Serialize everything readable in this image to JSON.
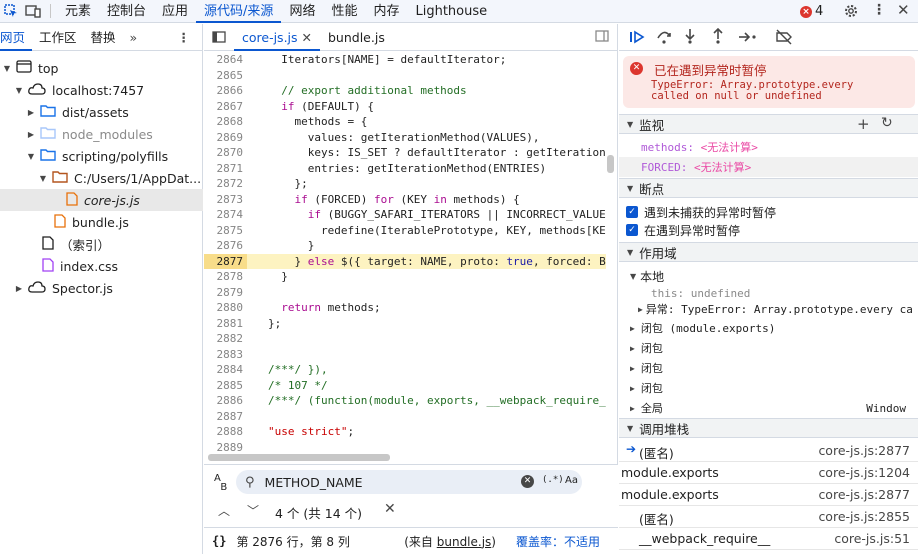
{
  "topbar": {
    "tabs": [
      "元素",
      "控制台",
      "应用",
      "源代码/来源",
      "网络",
      "性能",
      "内存",
      "Lighthouse"
    ],
    "active": "源代码/来源",
    "error_count": "4"
  },
  "navigator": {
    "tabs": [
      "网页",
      "工作区",
      "替换"
    ],
    "tree": [
      "top",
      "localhost:7457",
      "dist/assets",
      "node_modules",
      "scripting/polyfills",
      "C:/Users/1/AppDat...",
      "core-js.js",
      "bundle.js",
      "（索引）",
      "index.css",
      "Spector.js"
    ]
  },
  "editor": {
    "tabs": [
      "core-js.js",
      "bundle.js"
    ],
    "lines": [
      {
        "n": "2864",
        "t": "  Iterators[NAME] = defaultIterator;"
      },
      {
        "n": "2865",
        "t": ""
      },
      {
        "n": "2866",
        "t": "  // export additional methods"
      },
      {
        "n": "2867",
        "t": "  if (DEFAULT) {"
      },
      {
        "n": "2868",
        "t": "    methods = {"
      },
      {
        "n": "2869",
        "t": "      values: getIterationMethod(VALUES),"
      },
      {
        "n": "2870",
        "t": "      keys: IS_SET ? defaultIterator : getIteration"
      },
      {
        "n": "2871",
        "t": "      entries: getIterationMethod(ENTRIES)"
      },
      {
        "n": "2872",
        "t": "    };"
      },
      {
        "n": "2873",
        "t": "    if (FORCED) for (KEY in methods) {"
      },
      {
        "n": "2874",
        "t": "      if (BUGGY_SAFARI_ITERATORS || INCORRECT_VALUE"
      },
      {
        "n": "2875",
        "t": "        redefine(IterablePrototype, KEY, methods[KE"
      },
      {
        "n": "2876",
        "t": "      }"
      },
      {
        "n": "2877",
        "t": "    } else $({ target: NAME, proto: true, forced: B"
      },
      {
        "n": "2878",
        "t": "  }"
      },
      {
        "n": "2879",
        "t": ""
      },
      {
        "n": "2880",
        "t": "  return methods;"
      },
      {
        "n": "2881",
        "t": "};"
      },
      {
        "n": "2882",
        "t": ""
      },
      {
        "n": "2883",
        "t": ""
      },
      {
        "n": "2884",
        "t": "/***/ }),"
      },
      {
        "n": "2885",
        "t": "/* 107 */"
      },
      {
        "n": "2886",
        "t": "/***/ (function(module, exports, __webpack_require_"
      },
      {
        "n": "2887",
        "t": ""
      },
      {
        "n": "2888",
        "t": "\"use strict\";"
      },
      {
        "n": "2889",
        "t": ""
      }
    ],
    "search": {
      "query": "METHOD_NAME",
      "regex": "(.*)",
      "case": "Aa",
      "result": "4 个 (共 14 个)"
    },
    "status": {
      "position": "第 2876 行，第 8 列",
      "source_prefix": "(来自 ",
      "source_file": "bundle.js",
      "source_suffix": ")",
      "coverage": "覆盖率：不适用"
    }
  },
  "debugger": {
    "pause": {
      "title": "已在遇到异常时暂停",
      "message": "TypeError: Array.prototype.every\ncalled on null or undefined"
    },
    "watch": {
      "title": "监视",
      "items": [
        {
          "name": "methods:",
          "value": "<无法计算>"
        },
        {
          "name": "FORCED:",
          "value": "<无法计算>"
        }
      ]
    },
    "breakpoints": {
      "title": "断点",
      "items": [
        "遇到未捕获的异常时暂停",
        "在遇到异常时暂停"
      ]
    },
    "scope": {
      "title": "作用域",
      "local": "本地",
      "this_name": "this:",
      "this_value": "undefined",
      "exception": "异常: TypeError: Array.prototype.every ca",
      "closures": [
        "闭包 (module.exports)",
        "闭包",
        "闭包",
        "闭包"
      ],
      "global": "全局",
      "global_value": "Window"
    },
    "callstack": {
      "title": "调用堆栈",
      "frames": [
        {
          "fn": "(匿名)",
          "loc": "core-js.js:2877"
        },
        {
          "fn": "module.exports",
          "loc": "core-js.js:1204"
        },
        {
          "fn": "module.exports",
          "loc": "core-js.js:2877"
        },
        {
          "fn": "(匿名)",
          "loc": "core-js.js:2855"
        },
        {
          "fn": "__webpack_require__",
          "loc": "core-js.js:51"
        }
      ]
    }
  },
  "colors": {
    "accent": "#0b57d0",
    "error": "#dc362e",
    "highlight": "#fdf3c1"
  }
}
